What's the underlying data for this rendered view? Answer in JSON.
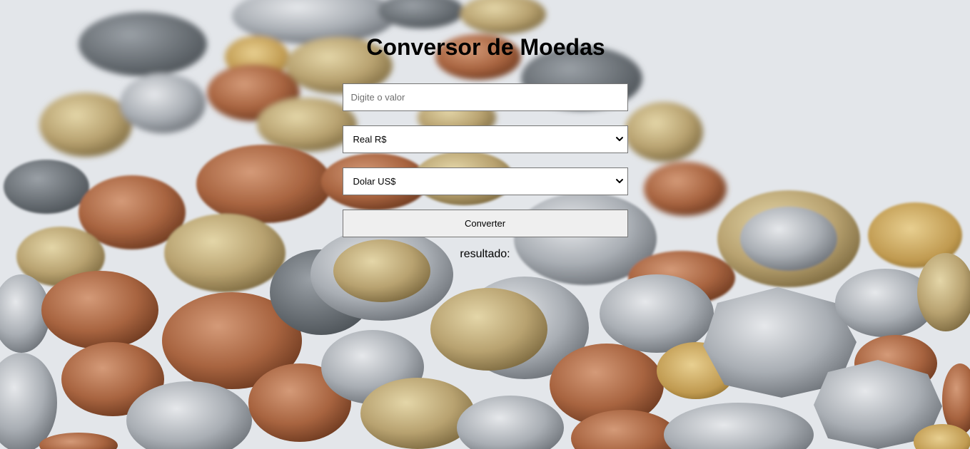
{
  "page": {
    "title": "Conversor de Moedas"
  },
  "form": {
    "amount_placeholder": "Digite o valor",
    "amount_value": "",
    "from_currency": {
      "selected": "Real R$"
    },
    "to_currency": {
      "selected": "Dolar US$"
    },
    "convert_label": "Converter",
    "result_label": "resultado:"
  },
  "icons": {
    "select_arrow": "chevron-down-icon"
  },
  "colors": {
    "background": "#e3e6ea",
    "button_bg": "#efefef",
    "field_border": "#767676"
  }
}
